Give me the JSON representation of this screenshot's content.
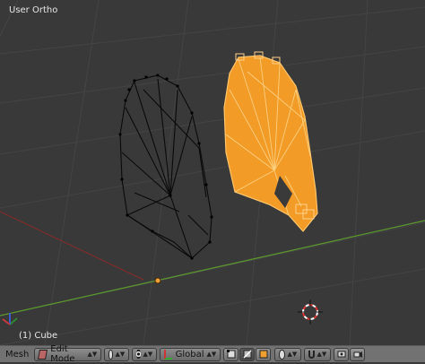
{
  "viewport": {
    "title": "User Ortho",
    "object_label": "(1) Cube"
  },
  "header": {
    "editor_label": "Mesh",
    "mode": "Edit Mode",
    "orientation": "Global"
  },
  "colors": {
    "viewport_bg": "#393939",
    "selected_mesh": "#f29b26",
    "unselected_wire": "#0a0a0a",
    "x_axis": "#8a2a2a",
    "y_axis": "#5c9a2d",
    "header_bg": "#727272"
  },
  "icons": [
    "view-mode-icon",
    "pivot-icon",
    "manipulator-icon",
    "vertex-select-icon",
    "edge-select-icon",
    "face-select-icon",
    "proportional-icon",
    "snap-icon",
    "render-icon",
    "camera-icon"
  ]
}
